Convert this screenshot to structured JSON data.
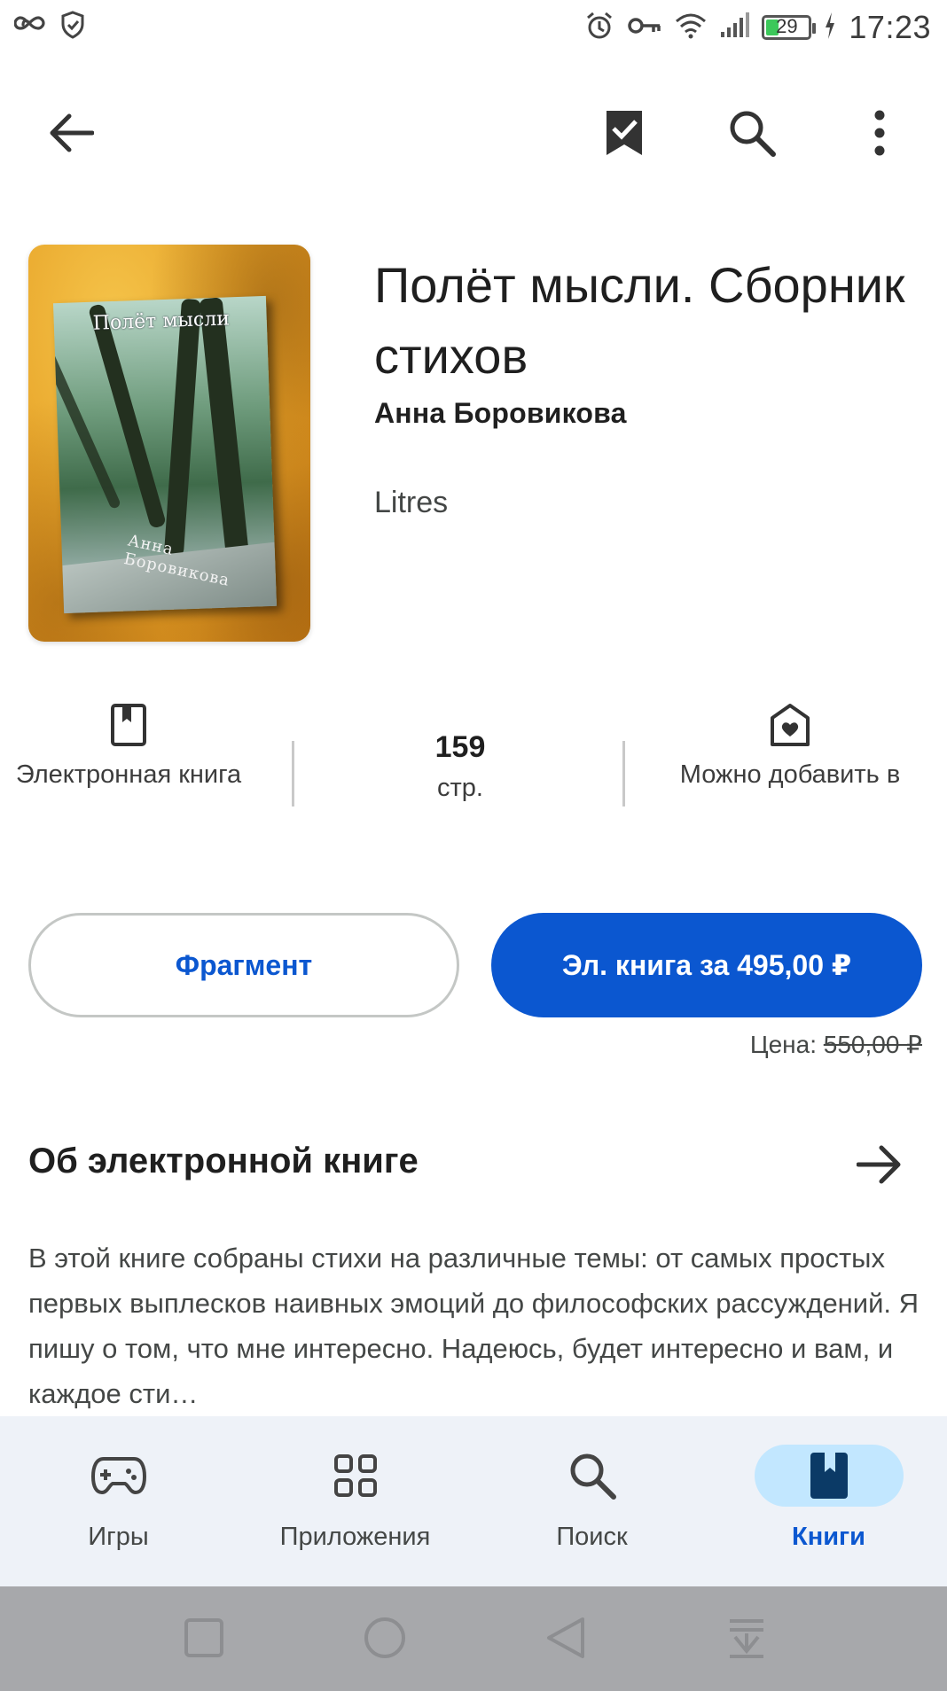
{
  "status_bar": {
    "time": "17:23",
    "battery_level": "29",
    "left_icons": [
      "infinity-icon",
      "shield-icon"
    ],
    "right_icons": [
      "alarm-icon",
      "key-icon",
      "wifi-icon",
      "signal-icon",
      "battery-icon",
      "charging-icon"
    ]
  },
  "app_bar": {
    "icons": [
      "back-arrow-icon",
      "bookmark-check-icon",
      "search-icon",
      "more-vert-icon"
    ]
  },
  "book": {
    "title": "Полёт мысли. Сборник стихов",
    "author": "Анна Боровикова",
    "publisher": "Litres",
    "cover_title": "Полёт мысли",
    "cover_author": "Анна Боровикова"
  },
  "info": {
    "format_label": "Электронная книга",
    "pages_value": "159",
    "pages_label": "стр.",
    "family_label": "Можно добавить в"
  },
  "actions": {
    "sample_label": "Фрагмент",
    "buy_label": "Эл. книга за 495,00 ₽",
    "price_prefix": "Цена:",
    "old_price": "550,00 ₽"
  },
  "about": {
    "title": "Об электронной книге",
    "description": "В этой книге собраны стихи на различные темы: от самых простых первых выплесков наивных эмоций до философских рассуждений. Я пишу о том, что мне интересно. Надеюсь, будет интересно и вам, и каждое сти…"
  },
  "bottom_nav": {
    "items": [
      {
        "label": "Игры",
        "icon": "gamepad-icon"
      },
      {
        "label": "Приложения",
        "icon": "apps-grid-icon"
      },
      {
        "label": "Поиск",
        "icon": "search-icon"
      },
      {
        "label": "Книги",
        "icon": "book-icon"
      }
    ],
    "active_index": 3
  },
  "colors": {
    "accent": "#0b57d0",
    "nav_active_pill": "#c2e7ff",
    "nav_background": "#eef2f8"
  }
}
